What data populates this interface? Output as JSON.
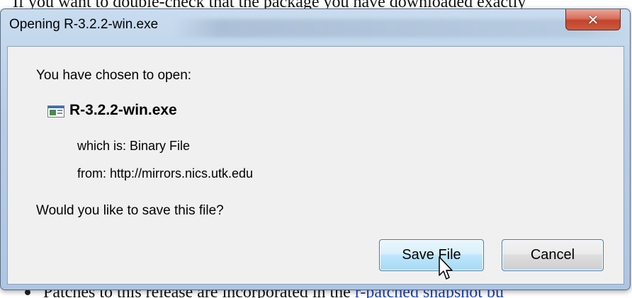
{
  "background": {
    "top_text": "If you want to double-check that the package you have downloaded exactly",
    "bottom_text": "Patches to this release are incorporated in the ",
    "bottom_link": "r-patched snapshot bu"
  },
  "dialog": {
    "title": "Opening R-3.2.2-win.exe",
    "close_icon": "close-icon",
    "prompt": "You have chosen to open:",
    "file_name": "R-3.2.2-win.exe",
    "file_icon": "executable-file-icon",
    "which_is": "which is: Binary File",
    "from": "from: http://mirrors.nics.utk.edu",
    "question": "Would you like to save this file?",
    "save_label": "Save File",
    "cancel_label": "Cancel"
  },
  "colors": {
    "titlebar": "#b7cde6",
    "close_button": "#c3432c",
    "client_bg": "#f0f0f0",
    "focused_button": "#bee6fd"
  }
}
